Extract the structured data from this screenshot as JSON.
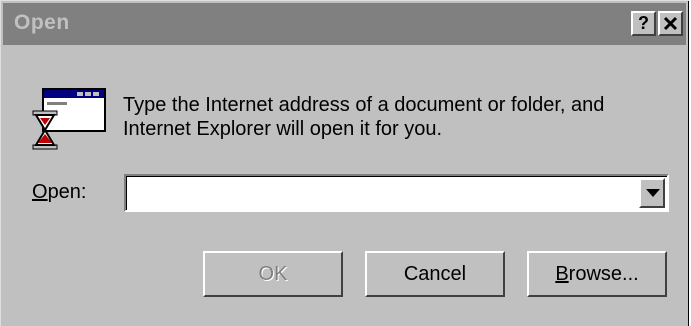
{
  "window": {
    "title": "Open",
    "help_label": "?",
    "close_label": "✕"
  },
  "icon": "open-document-hourglass-icon",
  "prompt": {
    "line1": "Type the Internet address of a document or folder, and",
    "line2": "Internet Explorer will open it for you."
  },
  "open_field": {
    "label_accel": "O",
    "label_rest": "pen:",
    "value": ""
  },
  "buttons": {
    "ok": "OK",
    "cancel": "Cancel",
    "browse_accel": "B",
    "browse_rest": "rowse..."
  },
  "colors": {
    "face": "#c0c0c0",
    "titlebar_inactive": "#808080",
    "disabled_text": "#808080"
  }
}
